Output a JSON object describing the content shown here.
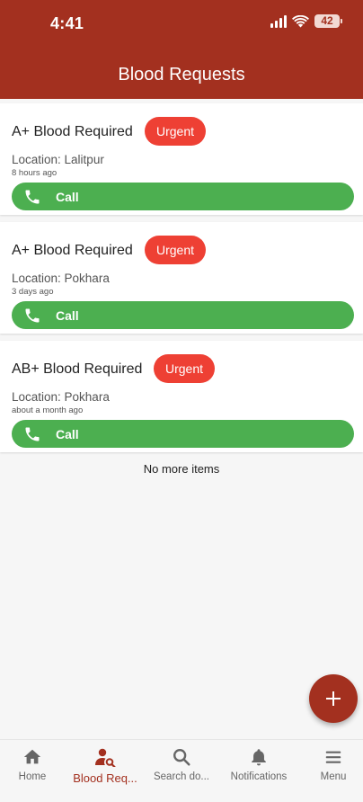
{
  "status_bar": {
    "time": "4:41",
    "battery": "42"
  },
  "header": {
    "title": "Blood Requests"
  },
  "requests": [
    {
      "title": "A+ Blood Required",
      "badge": "Urgent",
      "location": "Location: Lalitpur",
      "time": "8 hours ago",
      "call_label": "Call"
    },
    {
      "title": "A+ Blood Required",
      "badge": "Urgent",
      "location": "Location: Pokhara",
      "time": "3 days ago",
      "call_label": "Call"
    },
    {
      "title": "AB+ Blood Required",
      "badge": "Urgent",
      "location": "Location: Pokhara",
      "time": "about a month ago",
      "call_label": "Call"
    }
  ],
  "footer_text": "No more items",
  "fab": {
    "icon": "plus-icon"
  },
  "bottom_nav": [
    {
      "label": "Home",
      "icon": "home-icon",
      "active": false
    },
    {
      "label": "Blood Req...",
      "icon": "person-search-icon",
      "active": true
    },
    {
      "label": "Search do...",
      "icon": "search-icon",
      "active": false
    },
    {
      "label": "Notifications",
      "icon": "bell-icon",
      "active": false
    },
    {
      "label": "Menu",
      "icon": "menu-icon",
      "active": false
    }
  ],
  "colors": {
    "primary": "#a3301f",
    "urgent": "#ee4034",
    "call": "#4caf50",
    "background": "#f6f6f6"
  }
}
